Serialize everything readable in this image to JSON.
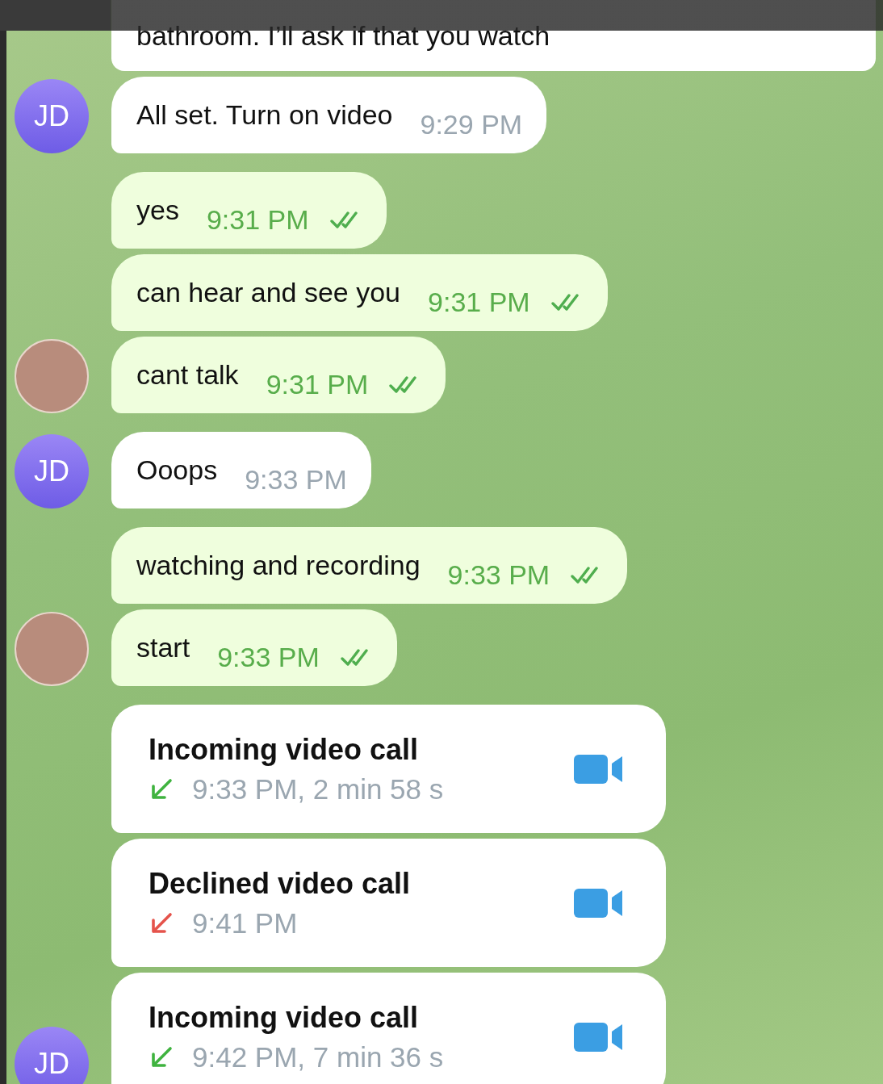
{
  "messages": [
    {
      "kind": "text",
      "outgoing": false,
      "text": "bathroom.  I’ll ask if that you watch"
    },
    {
      "kind": "text",
      "outgoing": false,
      "avatar": {
        "kind": "initials",
        "initials": "JD"
      },
      "text": "All set.  Turn on video",
      "time": "9:29 PM"
    },
    {
      "kind": "text",
      "outgoing": true,
      "read": true,
      "text": "yes",
      "time": "9:31 PM"
    },
    {
      "kind": "text",
      "outgoing": true,
      "read": true,
      "text": "can hear and see you",
      "time": "9:31 PM"
    },
    {
      "kind": "text",
      "outgoing": true,
      "read": true,
      "avatar": {
        "kind": "photo"
      },
      "text": "cant talk",
      "time": "9:31 PM"
    },
    {
      "kind": "text",
      "outgoing": false,
      "avatar": {
        "kind": "initials",
        "initials": "JD"
      },
      "text": "Ooops",
      "time": "9:33 PM"
    },
    {
      "kind": "text",
      "outgoing": true,
      "read": true,
      "text": "watching and recording",
      "time": "9:33 PM"
    },
    {
      "kind": "text",
      "outgoing": true,
      "read": true,
      "avatar": {
        "kind": "photo"
      },
      "text": "start",
      "time": "9:33 PM"
    },
    {
      "kind": "call",
      "outgoing": false,
      "title": "Incoming video call",
      "detail": "9:33 PM, 2 min 58 s",
      "declined": false
    },
    {
      "kind": "call",
      "outgoing": false,
      "title": "Declined video call",
      "detail": "9:41 PM",
      "declined": true
    },
    {
      "kind": "call",
      "outgoing": false,
      "avatar": {
        "kind": "initials",
        "initials": "JD"
      },
      "title": "Incoming video call",
      "detail": "9:42 PM, 7 min 36 s",
      "declined": false
    }
  ]
}
